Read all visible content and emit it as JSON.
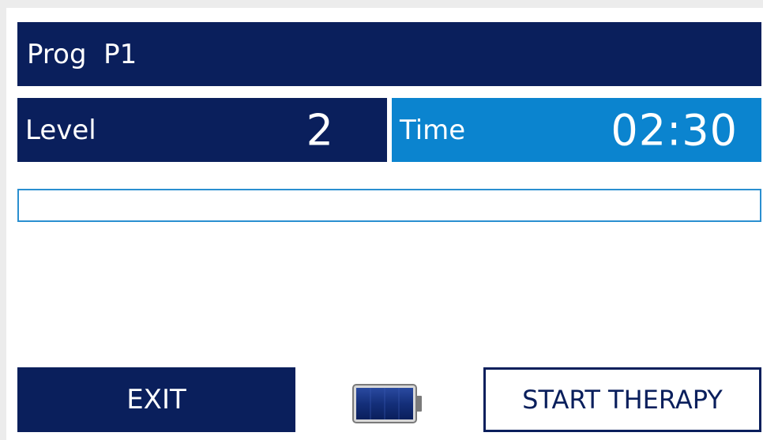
{
  "header": {
    "program_label": "Prog  P1"
  },
  "level": {
    "label": "Level",
    "value": "2"
  },
  "time": {
    "label": "Time",
    "value": "02:30"
  },
  "progress": {
    "fraction": 0
  },
  "buttons": {
    "exit_label": "EXIT",
    "start_label": "START THERAPY"
  },
  "battery": {
    "icon": "battery-icon",
    "fraction": 1
  },
  "colors": {
    "navy": "#0a1f5c",
    "accent_blue": "#0b84cf",
    "outline_blue": "#2a8fd0"
  }
}
